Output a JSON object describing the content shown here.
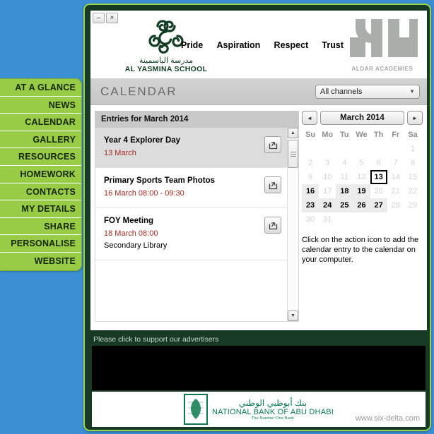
{
  "window": {
    "minimize_label": "–",
    "close_label": "×"
  },
  "header": {
    "school_name_ar": "مدرسة الياسمينة",
    "school_name_en": "AL YASMINA SCHOOL",
    "values": [
      "Pride",
      "Aspiration",
      "Respect",
      "Trust"
    ],
    "academies_label": "ALDAR ACADEMIES"
  },
  "sidebar": {
    "items": [
      {
        "label": "AT A GLANCE"
      },
      {
        "label": "NEWS"
      },
      {
        "label": "CALENDAR"
      },
      {
        "label": "GALLERY"
      },
      {
        "label": "RESOURCES"
      },
      {
        "label": "HOMEWORK"
      },
      {
        "label": "CONTACTS"
      },
      {
        "label": "MY DETAILS"
      },
      {
        "label": "SHARE"
      },
      {
        "label": "PERSONALISE"
      },
      {
        "label": "WEBSITE"
      }
    ]
  },
  "main": {
    "page_title": "CALENDAR",
    "channel_filter": {
      "selected": "All channels",
      "caret": "▼"
    },
    "entries_header": "Entries for March 2014",
    "entries": [
      {
        "title": "Year 4 Explorer Day",
        "date": "13 March",
        "location": "",
        "selected": true,
        "action_icon": "share-export-icon"
      },
      {
        "title": "Primary Sports Team Photos",
        "date": "16 March 08:00 - 09:30",
        "location": "",
        "selected": false,
        "action_icon": "share-export-icon"
      },
      {
        "title": "FOY Meeting",
        "date": "18 March 08:00",
        "location": "Secondary Library",
        "selected": false,
        "action_icon": "share-export-icon"
      }
    ],
    "scrollbar": {
      "up_arrow": "▲",
      "down_arrow": "▼"
    }
  },
  "calendar": {
    "prev_label": "◄",
    "next_label": "►",
    "month_label": "March 2014",
    "weekday_headers": [
      "Su",
      "Mo",
      "Tu",
      "We",
      "Th",
      "Fr",
      "Sa"
    ],
    "weeks": [
      [
        {
          "day": "",
          "state": "empty"
        },
        {
          "day": "",
          "state": "empty"
        },
        {
          "day": "",
          "state": "empty"
        },
        {
          "day": "",
          "state": "empty"
        },
        {
          "day": "",
          "state": "empty"
        },
        {
          "day": "",
          "state": "empty"
        },
        {
          "day": "1",
          "state": "plain"
        }
      ],
      [
        {
          "day": "2",
          "state": "plain"
        },
        {
          "day": "3",
          "state": "plain"
        },
        {
          "day": "4",
          "state": "plain"
        },
        {
          "day": "5",
          "state": "plain"
        },
        {
          "day": "6",
          "state": "plain"
        },
        {
          "day": "7",
          "state": "plain"
        },
        {
          "day": "8",
          "state": "plain"
        }
      ],
      [
        {
          "day": "9",
          "state": "plain"
        },
        {
          "day": "10",
          "state": "plain"
        },
        {
          "day": "11",
          "state": "plain"
        },
        {
          "day": "12",
          "state": "plain"
        },
        {
          "day": "13",
          "state": "today"
        },
        {
          "day": "14",
          "state": "plain"
        },
        {
          "day": "15",
          "state": "plain"
        }
      ],
      [
        {
          "day": "16",
          "state": "has-events"
        },
        {
          "day": "17",
          "state": "plain"
        },
        {
          "day": "18",
          "state": "has-events"
        },
        {
          "day": "19",
          "state": "has-events"
        },
        {
          "day": "20",
          "state": "plain"
        },
        {
          "day": "21",
          "state": "plain"
        },
        {
          "day": "22",
          "state": "plain"
        }
      ],
      [
        {
          "day": "23",
          "state": "has-events"
        },
        {
          "day": "24",
          "state": "has-events"
        },
        {
          "day": "25",
          "state": "has-events"
        },
        {
          "day": "26",
          "state": "has-events"
        },
        {
          "day": "27",
          "state": "has-events"
        },
        {
          "day": "28",
          "state": "plain"
        },
        {
          "day": "29",
          "state": "plain"
        }
      ],
      [
        {
          "day": "30",
          "state": "plain"
        },
        {
          "day": "31",
          "state": "plain"
        },
        {
          "day": "",
          "state": "empty"
        },
        {
          "day": "",
          "state": "empty"
        },
        {
          "day": "",
          "state": "empty"
        },
        {
          "day": "",
          "state": "empty"
        },
        {
          "day": "",
          "state": "empty"
        }
      ]
    ],
    "hint": "Click on the action icon to add the calendar entry to the calendar on your computer."
  },
  "advert": {
    "label": "Please click to support our advertisers",
    "bank_name_ar": "بنك أبوظبي الوطني",
    "bank_name_en": "NATIONAL BANK OF ABU DHABI",
    "bank_tagline": "The Number One Bank",
    "site_url": "www.six-delta.com"
  },
  "colors": {
    "page_background": "#3b8fd2",
    "sidebar_green": "#98cb46",
    "frame_dark_green": "#173a24",
    "frame_light_green": "#9ad34d",
    "entry_date_red": "#a32a22",
    "bank_green": "#0a7a4e"
  }
}
